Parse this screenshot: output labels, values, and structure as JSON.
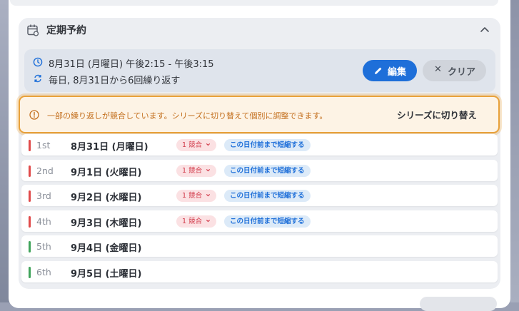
{
  "section": {
    "title": "定期予約"
  },
  "summary": {
    "datetime": "8月31日 (月曜日) 午後2:15 - 午後3:15",
    "repeat": "毎日, 8月31日から6回繰り返す",
    "edit_label": "編集",
    "clear_label": "クリア"
  },
  "alert": {
    "message": "一部の繰り返しが競合しています。シリーズに切り替えて個別に調整できます。",
    "action_label": "シリーズに切り替え"
  },
  "occurrences": [
    {
      "ord": "1st",
      "date": "8月31日 (月曜日)",
      "conflict": "1 競合",
      "shorten": "この日付前まで短縮する",
      "status_color": "#e04a4a"
    },
    {
      "ord": "2nd",
      "date": "9月1日 (火曜日)",
      "conflict": "1 競合",
      "shorten": "この日付前まで短縮する",
      "status_color": "#e04a4a"
    },
    {
      "ord": "3rd",
      "date": "9月2日 (水曜日)",
      "conflict": "1 競合",
      "shorten": "この日付前まで短縮する",
      "status_color": "#e04a4a"
    },
    {
      "ord": "4th",
      "date": "9月3日 (木曜日)",
      "conflict": "1 競合",
      "shorten": "この日付前まで短縮する",
      "status_color": "#e04a4a"
    },
    {
      "ord": "5th",
      "date": "9月4日 (金曜日)",
      "status_color": "#3fa35a"
    },
    {
      "ord": "6th",
      "date": "9月5日 (土曜日)",
      "status_color": "#3fa35a"
    }
  ],
  "colors": {
    "accent": "#1e6fd9",
    "warning": "#e8a13a",
    "conflict": "#d23a4a",
    "ok": "#3fa35a"
  }
}
